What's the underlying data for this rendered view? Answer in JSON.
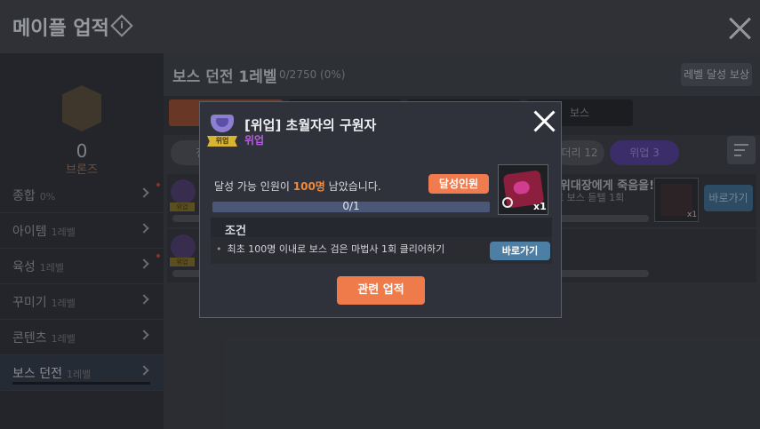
{
  "header": {
    "title": "메이플 업적"
  },
  "sidebar": {
    "badge_count": "0",
    "badge_label": "브론즈",
    "items": [
      {
        "label": "종합",
        "level": "0%"
      },
      {
        "label": "아이템",
        "level": "1레벨"
      },
      {
        "label": "육성",
        "level": "1레벨"
      },
      {
        "label": "꾸미기",
        "level": "1레벨"
      },
      {
        "label": "콘텐츠",
        "level": "1레벨"
      },
      {
        "label": "보스 던전",
        "level": "1레벨"
      }
    ]
  },
  "main": {
    "title": "보스 던전",
    "level": "1레벨",
    "progress": "0/2750 (0%)",
    "reward_button": "레벨 달성 보상",
    "tab_partial_right": "보스",
    "filter_partial_left": "전",
    "filter_partial_mid": "더리 12",
    "filter_purple": "위업 3",
    "row1": {
      "tag": "위업",
      "title": "!위대장에게 죽음을!",
      "subtitle": "로 보스 듣텔 1회",
      "reward_qty": "x1",
      "go": "바로가기"
    },
    "row2": {
      "tag": "위업"
    }
  },
  "modal": {
    "ribbon": "위업",
    "title": "[위업] 초월자의 구원자",
    "category": "위업",
    "remaining_prefix": "달성 가능 인원이",
    "remaining_value": "100명",
    "remaining_suffix": "남았습니다.",
    "achievers_button": "달성인원",
    "reward_qty": "x1",
    "progress_text": "0/1",
    "progress_fraction": 0,
    "condition_header": "조건",
    "condition_bullet": "•",
    "condition_text": "최초 100명 이내로 보스 검은 마법사 1회 클리어하기",
    "go_button": "바로가기",
    "related_button": "관련 업적"
  },
  "colors": {
    "accent_orange": "#ef7b4f",
    "go_blue": "#4d7ea3",
    "category_purple": "#b55ce0"
  }
}
